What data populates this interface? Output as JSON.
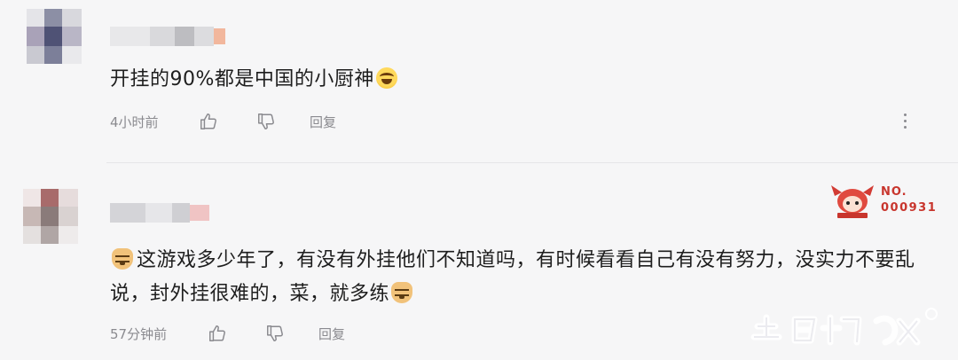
{
  "comments": [
    {
      "text": "开挂的90%都是中国的小厨神",
      "time": "4小时前",
      "reply_label": "回复"
    },
    {
      "text_part1": "这游戏多少年了，有没有外挂他们不知道吗，有时候看看自己有没有努力，没实力不要乱说，封外挂很难的，菜，就多练",
      "time": "57分钟前",
      "reply_label": "回复",
      "badge": {
        "label": "NO.",
        "number": "000931"
      }
    }
  ],
  "icons": {
    "like": "thumbs-up-icon",
    "dislike": "thumbs-down-icon",
    "more": "more-vertical-icon",
    "emoji_laugh": "laughing-tears-emoji",
    "emoji_doge": "doge-emoji"
  },
  "colors": {
    "background": "#f6f6f7",
    "text": "#1e1e1e",
    "meta": "#8a8a8f",
    "badge": "#c8352d"
  }
}
